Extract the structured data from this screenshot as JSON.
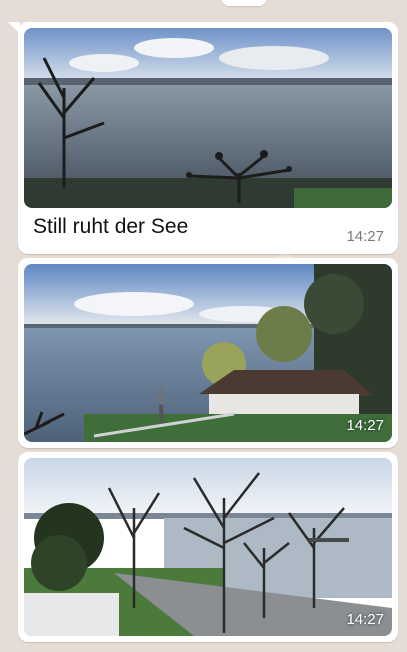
{
  "messages": [
    {
      "type": "image",
      "caption": "Still ruht der See",
      "time": "14:27",
      "image_icon": "lake-tree-photo-icon"
    },
    {
      "type": "image",
      "caption": "",
      "time": "14:27",
      "image_icon": "lake-house-photo-icon"
    },
    {
      "type": "image",
      "caption": "",
      "time": "14:27",
      "image_icon": "lake-promenade-photo-icon"
    }
  ],
  "colors": {
    "chat_background": "#e5ddd5",
    "bubble": "#ffffff",
    "timestamp": "#7a7a7a"
  }
}
